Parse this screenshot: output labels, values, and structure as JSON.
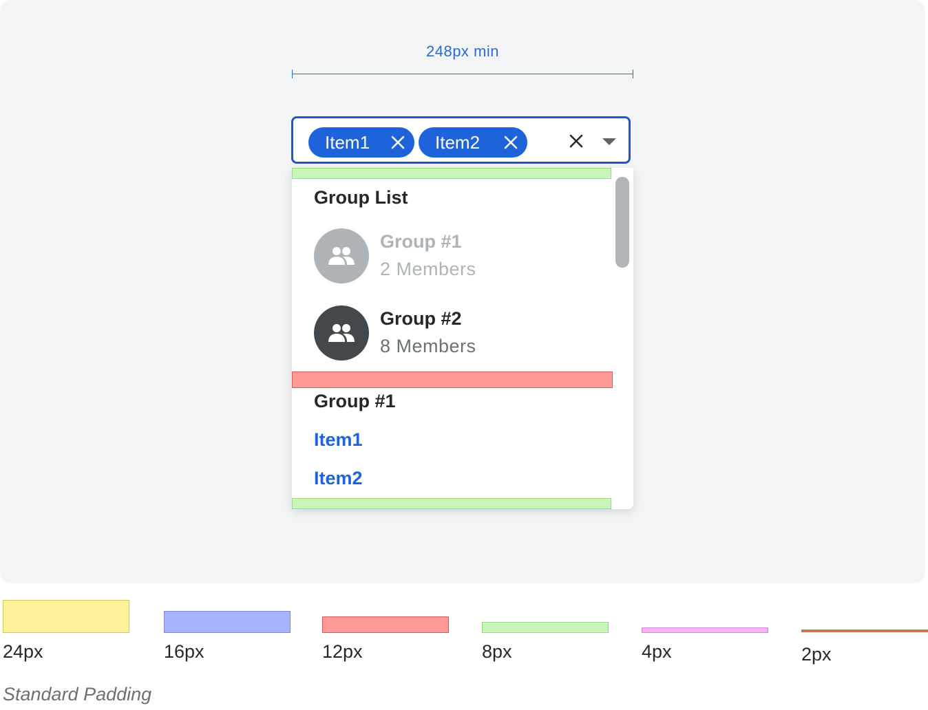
{
  "annotation": {
    "min_width_label": "248px min"
  },
  "select": {
    "chips": [
      {
        "label": "Item1"
      },
      {
        "label": "Item2"
      }
    ],
    "clear_icon": "close-icon",
    "toggle_icon": "caret-down-icon"
  },
  "dropdown": {
    "header": "Group List",
    "groups": [
      {
        "name": "Group #1",
        "members": "2 Members",
        "state": "disabled",
        "avatar_color": "#aeb3b8",
        "icon": "people-icon"
      },
      {
        "name": "Group #2",
        "members": "8 Members",
        "state": "enabled",
        "avatar_color": "#43484d",
        "icon": "people-icon"
      }
    ],
    "section_title": "Group #1",
    "items": [
      "Item1",
      "Item2"
    ]
  },
  "legend": {
    "items": [
      {
        "label": "24px",
        "color": "#fff09a"
      },
      {
        "label": "16px",
        "color": "#a7b4ff"
      },
      {
        "label": "12px",
        "color": "#ff9a98"
      },
      {
        "label": "8px",
        "color": "#c8f5b8"
      },
      {
        "label": "4px",
        "color": "#f6b3f4"
      },
      {
        "label": "2px",
        "color": "#c07c58"
      }
    ],
    "caption": "Standard Padding"
  },
  "colors": {
    "accent": "#1e63d9",
    "border_active": "#1e57c8",
    "canvas": "#f3f4f6"
  }
}
